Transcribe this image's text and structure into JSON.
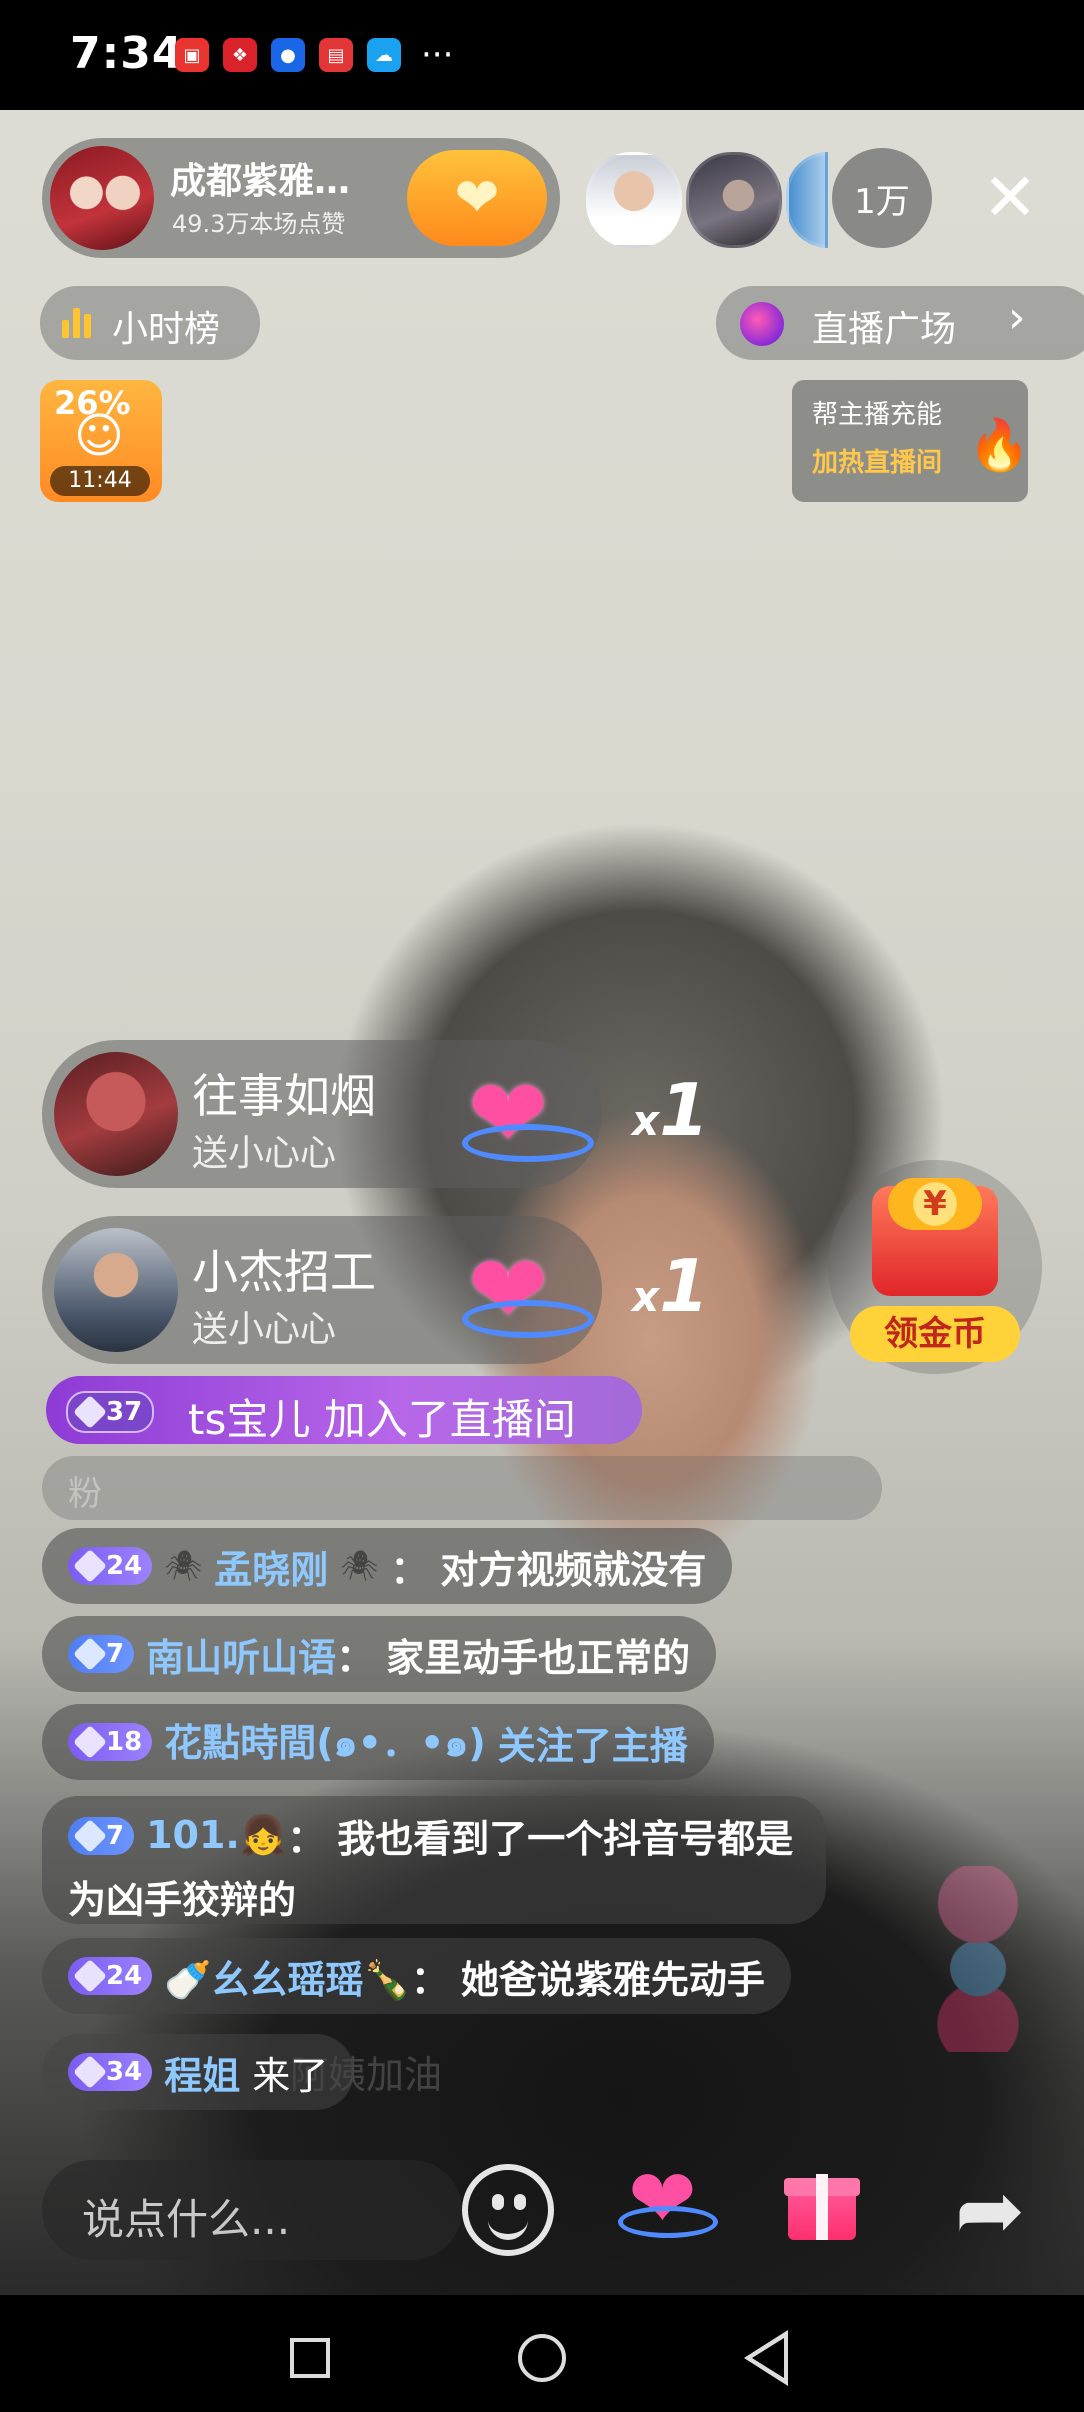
{
  "status_bar": {
    "time": "7:34",
    "app_icons": [
      "huawei-store-icon",
      "app-red-icon",
      "app-blue-bulb-icon",
      "app-red-icon-2",
      "cloud-icon"
    ],
    "more": "···"
  },
  "anchor": {
    "name": "成都紫雅…",
    "likes": "49.3万本场点赞"
  },
  "viewers": {
    "count": "1万"
  },
  "badges": {
    "hour_rank": "小时榜",
    "plaza": "直播广场",
    "task_percent": "26%",
    "task_timer": "11:44",
    "heat_line1": "帮主播充能",
    "heat_line2": "加热直播间"
  },
  "gifts": [
    {
      "name": "往事如烟",
      "action": "送小心心",
      "mult_x": "x",
      "mult_n": "1"
    },
    {
      "name": "小杰招工",
      "action": "送小心心",
      "mult_x": "x",
      "mult_n": "1"
    }
  ],
  "coin": {
    "label": "领金币",
    "chest_symbol": "¥"
  },
  "join_message": {
    "level": "37",
    "text": "ts宝儿 加入了直播间"
  },
  "fan_stub": "粉",
  "chat": [
    {
      "level": "24",
      "deco_left": "🕷",
      "user": "孟晓刚",
      "deco_right": "🕷",
      "sep": "：",
      "content": "对方视频就没有"
    },
    {
      "level": "7",
      "user": "南山听山语",
      "sep": "：",
      "content": "家里动手也正常的"
    },
    {
      "level": "18",
      "user": "花點時間(๑•．•๑)",
      "content": "关注了主播"
    },
    {
      "level": "7",
      "user": "101.👧",
      "sep": "：",
      "content": "我也看到了一个抖音号都是",
      "content2": "为凶手狡辩的"
    },
    {
      "level": "24",
      "user": "🍼幺幺瑶瑶🍾",
      "sep": "：",
      "content": "她爸说紫雅先动手"
    },
    {
      "level": "34",
      "user": "程姐",
      "content": "来了"
    }
  ],
  "faded_text": "阿姨加油",
  "bottom": {
    "input_placeholder": "说点什么..."
  }
}
